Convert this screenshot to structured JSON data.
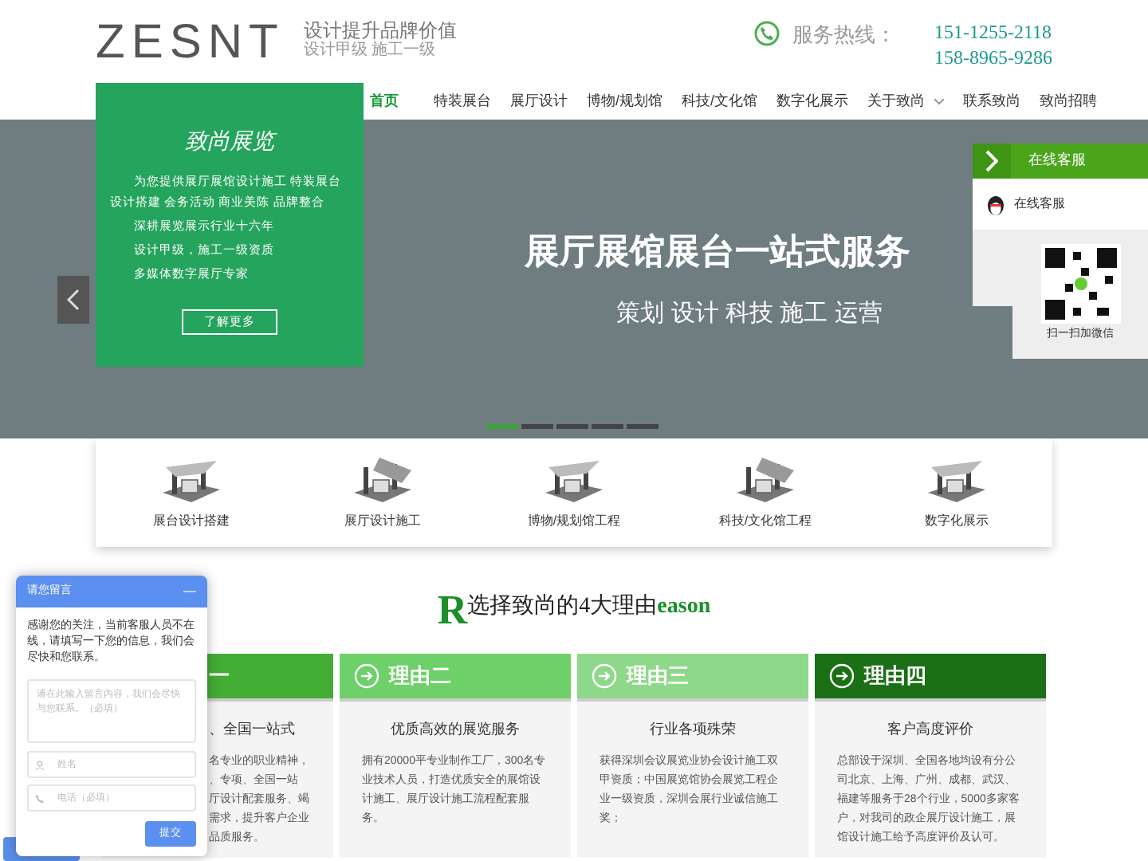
{
  "header": {
    "logo": "ZESNT",
    "slogan": "设计提升品牌价值",
    "subslogan": "设计甲级 施工一级",
    "hotline_label": "服务热线：",
    "phones": [
      "151-1255-2118",
      "158-8965-9286"
    ]
  },
  "nav": [
    {
      "label": "首页",
      "selected": true,
      "dropdown": false
    },
    {
      "label": "特装展台",
      "selected": false,
      "dropdown": false
    },
    {
      "label": "展厅设计",
      "selected": false,
      "dropdown": false
    },
    {
      "label": "博物/规划馆",
      "selected": false,
      "dropdown": false
    },
    {
      "label": "科技/文化馆",
      "selected": false,
      "dropdown": false
    },
    {
      "label": "数字化展示",
      "selected": false,
      "dropdown": false
    },
    {
      "label": "关于致尚",
      "selected": false,
      "dropdown": true
    },
    {
      "label": "联系致尚",
      "selected": false,
      "dropdown": false
    },
    {
      "label": "致尚招聘",
      "selected": false,
      "dropdown": false
    }
  ],
  "intro_box": {
    "title": "致尚展览",
    "paragraphs": [
      "为您提供展厅展馆设计施工 特装展台设计搭建 会务活动 商业美陈 品牌整合",
      "深耕展览展示行业十六年",
      "设计甲级，施工一级资质",
      "多媒体数字展厅专家"
    ],
    "button": "了解更多"
  },
  "banner": {
    "headline": "展厅展馆展台一站式服务",
    "subline": "策划 设计 科技 施工 运营",
    "dots": [
      {
        "selected": true
      },
      {
        "selected": false
      },
      {
        "selected": false
      },
      {
        "selected": false
      },
      {
        "selected": false
      }
    ]
  },
  "side_panel": {
    "title": "在线客服",
    "qq_label": "在线客服",
    "qr_caption": "扫一扫加微信"
  },
  "services": [
    "展台设计搭建",
    "展厅设计施工",
    "博物/规划馆工程",
    "科技/文化馆工程",
    "数字化展示"
  ],
  "reasons_title": {
    "big_letter": "R",
    "text": "选择致尚的4大理由",
    "tail": "eason"
  },
  "reasons": [
    {
      "heading": "一",
      "title": "、全国一站式",
      "lines": [
        "名专业的职业精神，",
        "、专项、全国一站",
        "厅设计配套服务、竭",
        "需求，提升客户企业",
        "品质服务。"
      ],
      "color": "#43ad36",
      "kind": "cut"
    },
    {
      "heading": "理由二",
      "title": "优质高效的展览服务",
      "body": "拥有20000平专业制作工厂，300名专业技术人员，打造优质安全的展馆设计施工、展厅设计施工流程配套服务。",
      "color": "#6dd068",
      "kind": "full"
    },
    {
      "heading": "理由三",
      "title": "行业各项殊荣",
      "body": "获得深圳会议展览业协会设计施工双甲资质；中国展览馆协会展览工程企业一级资质，深圳会展行业诚信施工奖；",
      "color": "#8ed88a",
      "kind": "full"
    },
    {
      "heading": "理由四",
      "title": "客户高度评价",
      "body": "总部设于深圳、全国各地均设有分公司北京、上海、广州、成都、武汉、福建等服务于28个行业，5000多家客户，对我司的政企展厅设计施工，展馆设计施工给予高度评价及认可。",
      "color": "#1b6f15",
      "kind": "full"
    }
  ],
  "chat": {
    "title": "请您留言",
    "minimize": "—",
    "notice": "感谢您的关注，当前客服人员不在线，请填写一下您的信息，我们会尽快和您联系。",
    "message_placeholder": "请在此输入留言内容，我们会尽快与您联系。（必填）",
    "name_placeholder": "姓名",
    "phone_placeholder": "电话（必填）",
    "submit": "提交"
  }
}
